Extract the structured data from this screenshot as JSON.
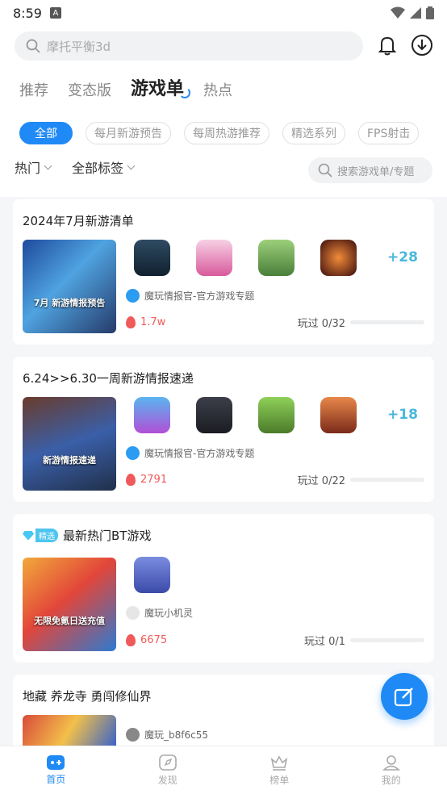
{
  "status_bar": {
    "time": "8:59"
  },
  "search": {
    "placeholder": "摩托平衡3d"
  },
  "tabs": [
    {
      "label": "推荐"
    },
    {
      "label": "变态版"
    },
    {
      "label": "游戏单"
    },
    {
      "label": "热点"
    }
  ],
  "chips": [
    "全部",
    "每月新游预告",
    "每周热游推荐",
    "精选系列",
    "FPS射击"
  ],
  "filters": {
    "sort": "热门",
    "tags": "全部标签",
    "search_placeholder": "搜索游戏单/专题"
  },
  "cards": [
    {
      "title": "2024年7月新游清单",
      "cover_text": "7月 新游情报预告",
      "more": "+28",
      "author": "魔玩情报官-官方游戏专题",
      "heat": "1.7w",
      "played": "玩过 0/32",
      "progress": 0
    },
    {
      "title": "6.24>>6.30一周新游情报速递",
      "cover_text": "新游情报速递",
      "more": "+18",
      "author": "魔玩情报官-官方游戏专题",
      "heat": "2791",
      "played": "玩过 0/22",
      "progress": 0
    },
    {
      "badge": "精选",
      "title": "最新热门BT游戏",
      "cover_text": "无限免氪日送充值",
      "author": "魔玩小机灵",
      "heat": "6675",
      "played": "玩过 0/1",
      "progress": 0
    },
    {
      "title": "地藏  养龙寺  勇闯修仙界",
      "author": "魔玩_b8f6c55"
    }
  ],
  "bottom_nav": [
    {
      "label": "首页"
    },
    {
      "label": "发现"
    },
    {
      "label": "榜单"
    },
    {
      "label": "我的"
    }
  ],
  "colors": {
    "accent": "#1f8af5",
    "heat": "#f05a5a",
    "more": "#4ab7dc"
  }
}
